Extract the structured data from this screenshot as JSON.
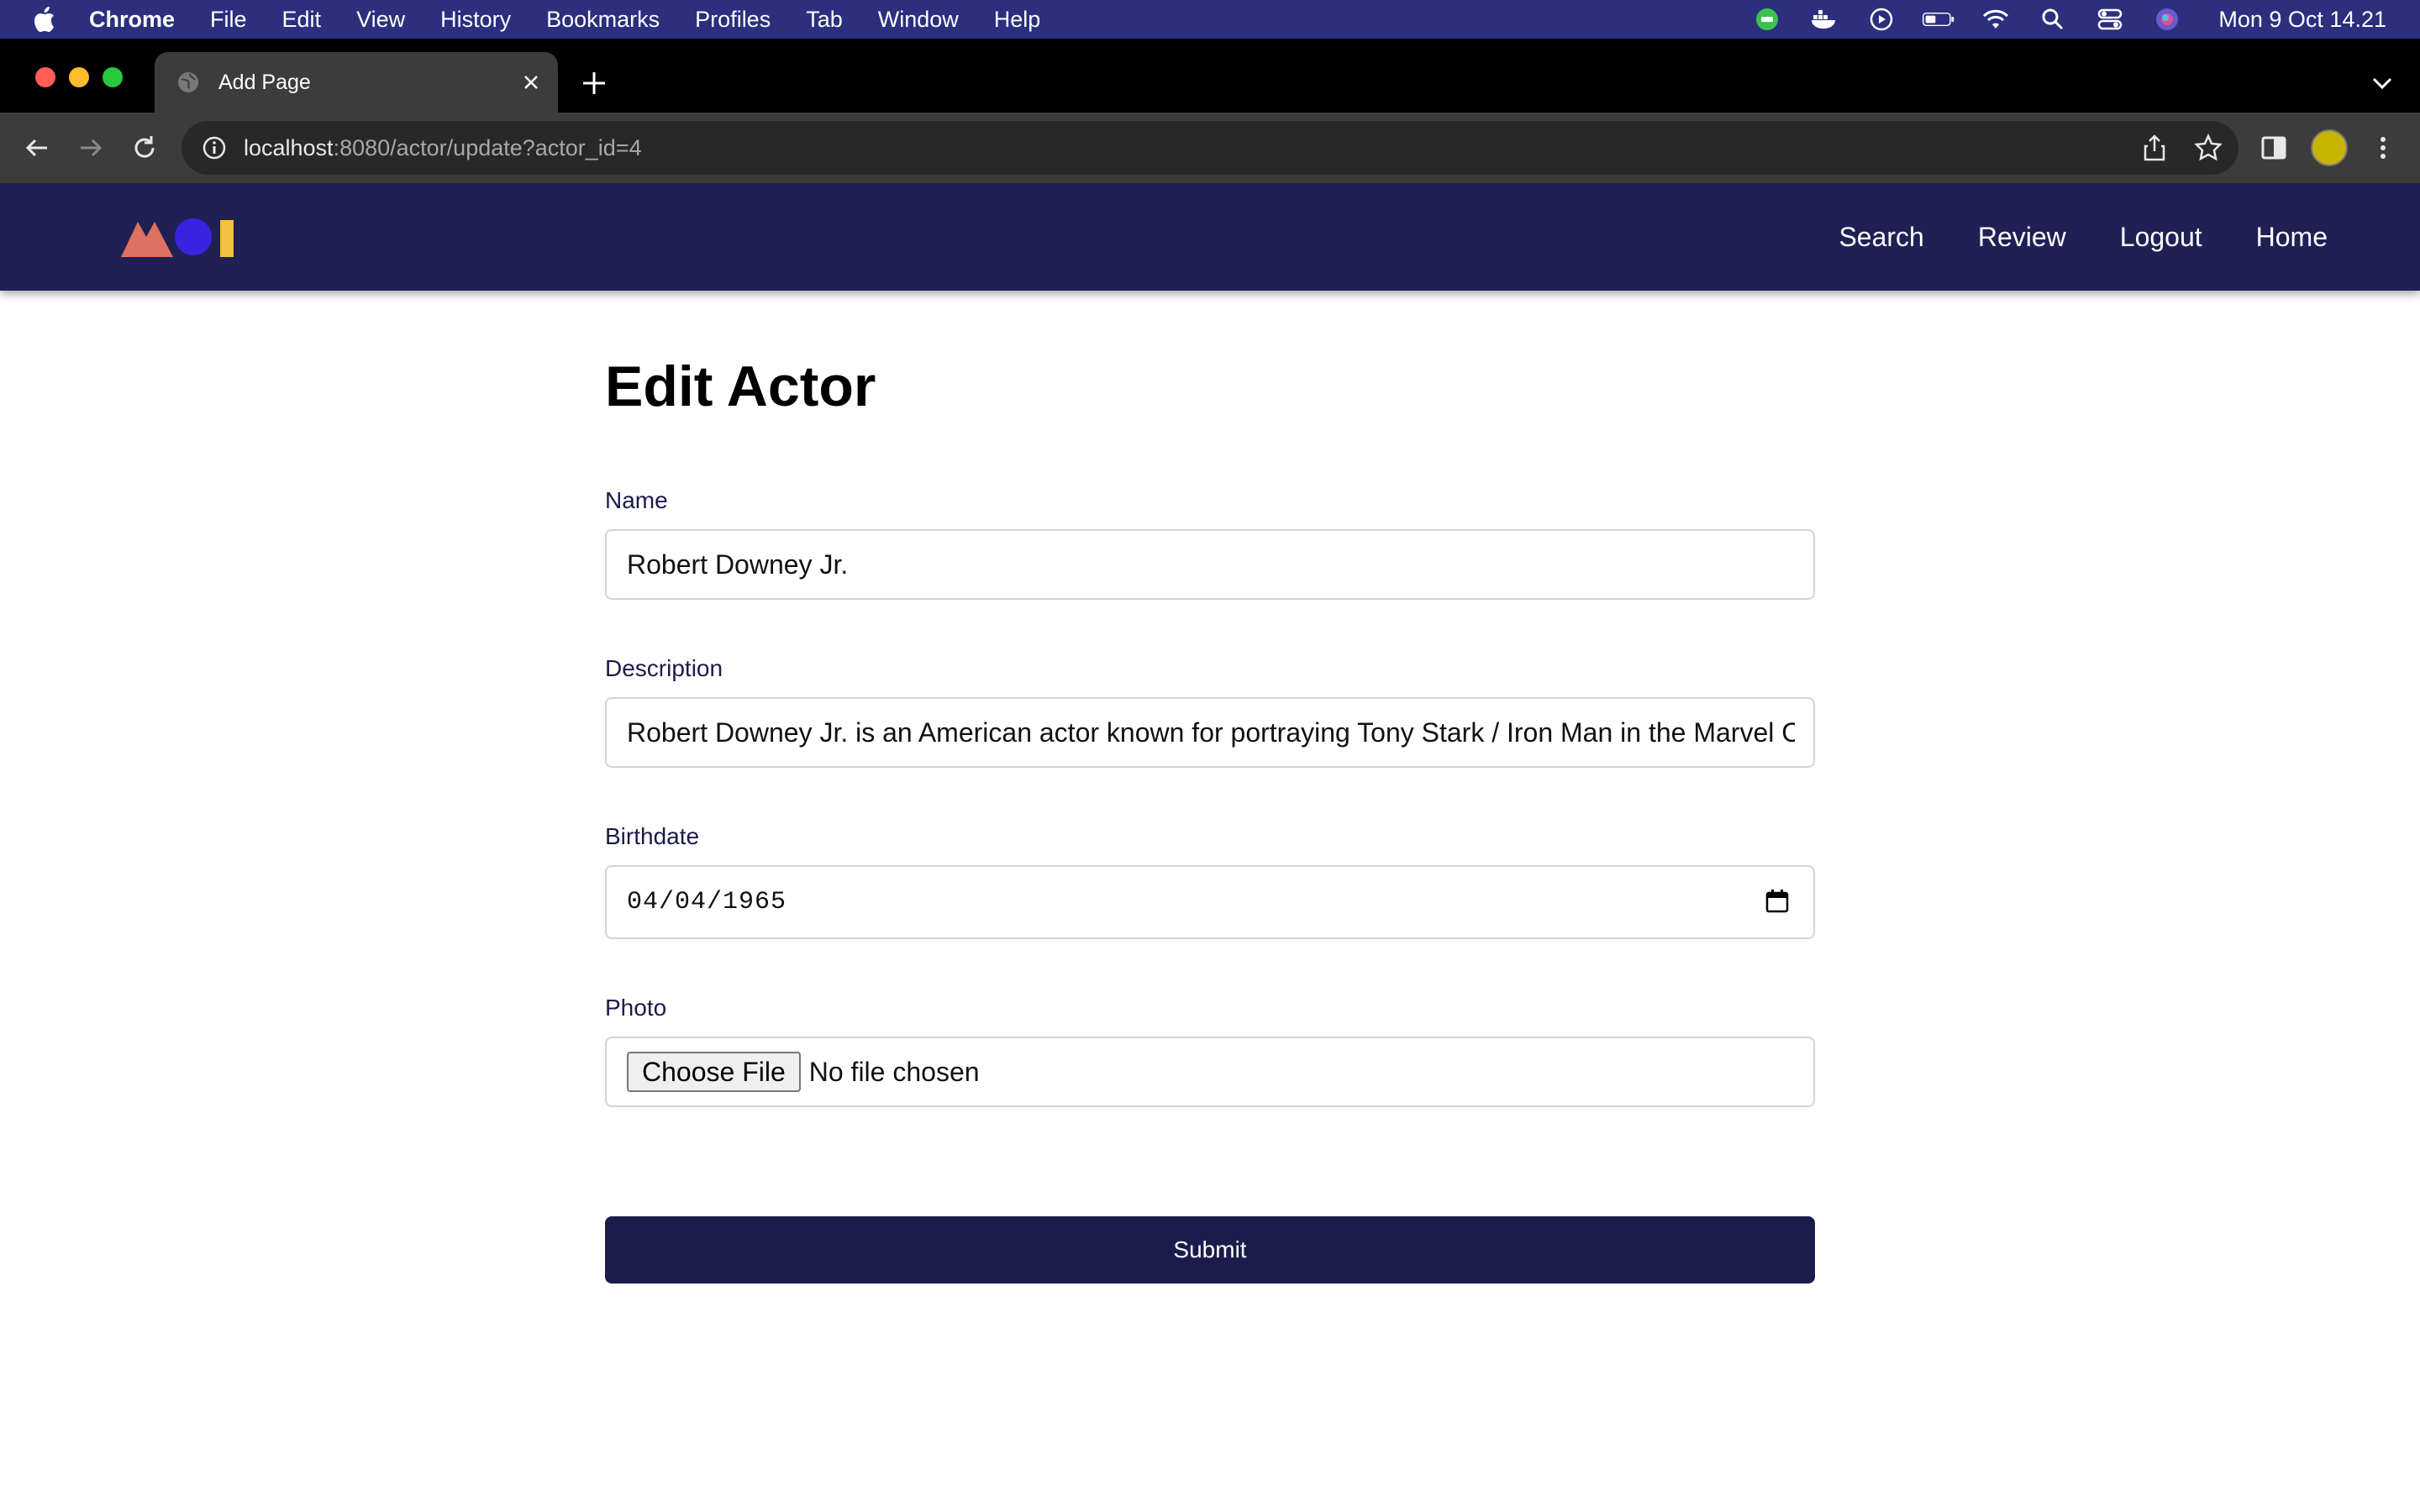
{
  "menubar": {
    "app_name": "Chrome",
    "items": [
      "File",
      "Edit",
      "View",
      "History",
      "Bookmarks",
      "Profiles",
      "Tab",
      "Window",
      "Help"
    ],
    "clock": "Mon 9 Oct  14.21"
  },
  "browser": {
    "tab_title": "Add Page",
    "url_host": "localhost",
    "url_path": ":8080/actor/update?actor_id=4"
  },
  "site_nav": {
    "links": [
      "Search",
      "Review",
      "Logout",
      "Home"
    ]
  },
  "form": {
    "title": "Edit Actor",
    "name_label": "Name",
    "name_value": "Robert Downey Jr.",
    "description_label": "Description",
    "description_value": "Robert Downey Jr. is an American actor known for portraying Tony Stark / Iron Man in the Marvel Cinematic Universe",
    "birthdate_label": "Birthdate",
    "birthdate_value": "04/04/1965",
    "photo_label": "Photo",
    "choose_file_label": "Choose File",
    "file_status": "No file chosen",
    "submit_label": "Submit"
  },
  "colors": {
    "menubar_bg": "#2b2f7e",
    "navbar_bg": "#202054",
    "submit_bg": "#1c1c4c",
    "logo_triangle": "#e07060",
    "logo_circle": "#3a22e0",
    "logo_bar": "#f0c040"
  }
}
